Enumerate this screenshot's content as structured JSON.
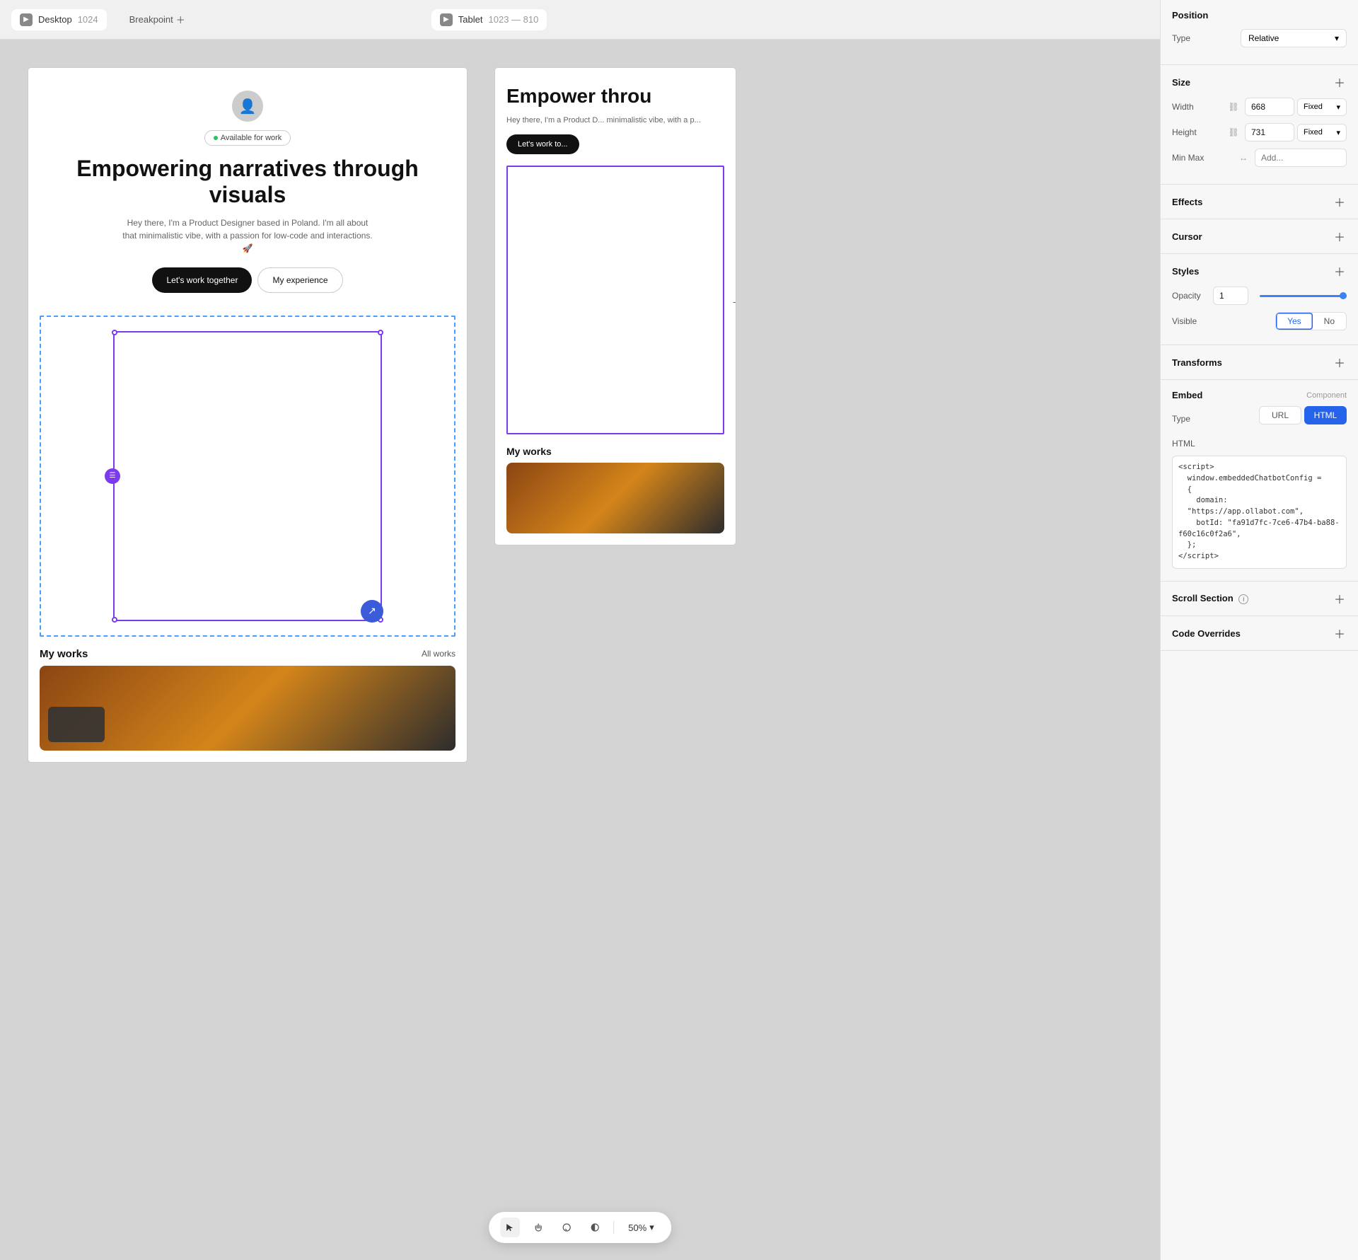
{
  "topBar": {
    "desktop_label": "Desktop",
    "desktop_size": "1024",
    "breakpoint_label": "Breakpoint",
    "tablet_label": "Tablet",
    "tablet_size": "1023 — 810"
  },
  "desktopFrame": {
    "available_text": "Available for work",
    "title": "Empowering narratives through visuals",
    "description": "Hey there, I'm a Product Designer based in Poland. I'm all about that minimalistic vibe, with a passion for low-code and interactions. 🚀",
    "btn_work": "Let's work together",
    "btn_experience": "My experience",
    "my_works": "My works",
    "all_works": "All works"
  },
  "tabletFrame": {
    "title": "Empower throu",
    "description": "Hey there, I'm a Product D... minimalistic vibe, with a p...",
    "btn_work": "Let's work to...",
    "my_works": "My works"
  },
  "toolbar": {
    "zoom": "50%"
  },
  "rightPanel": {
    "position": {
      "title": "Position",
      "type_label": "Type",
      "type_value": "Relative"
    },
    "size": {
      "title": "Size",
      "width_label": "Width",
      "width_value": "668",
      "width_mode": "Fixed",
      "height_label": "Height",
      "height_value": "731",
      "height_mode": "Fixed",
      "min_max_label": "Min Max",
      "min_max_placeholder": "Add..."
    },
    "effects": {
      "title": "Effects"
    },
    "cursor": {
      "title": "Cursor"
    },
    "styles": {
      "title": "Styles",
      "opacity_label": "Opacity",
      "opacity_value": "1",
      "visible_label": "Visible",
      "visible_yes": "Yes",
      "visible_no": "No"
    },
    "transforms": {
      "title": "Transforms"
    },
    "embed": {
      "title": "Embed",
      "component_label": "Component",
      "type_label": "Type",
      "url_btn": "URL",
      "html_btn": "HTML",
      "html_label": "HTML",
      "html_value": "<script>\n  window.embeddedChatbotConfig =\n  {\n    domain:\n  \"https://app.ollabot.com\",\n    botId: \"fa91d7fc-7ce6-47b4-ba88-f60c16c0f2a6\",\n  };\n</script>"
    },
    "scroll_section": {
      "title": "Scroll Section"
    },
    "code_overrides": {
      "title": "Code Overrides"
    }
  }
}
